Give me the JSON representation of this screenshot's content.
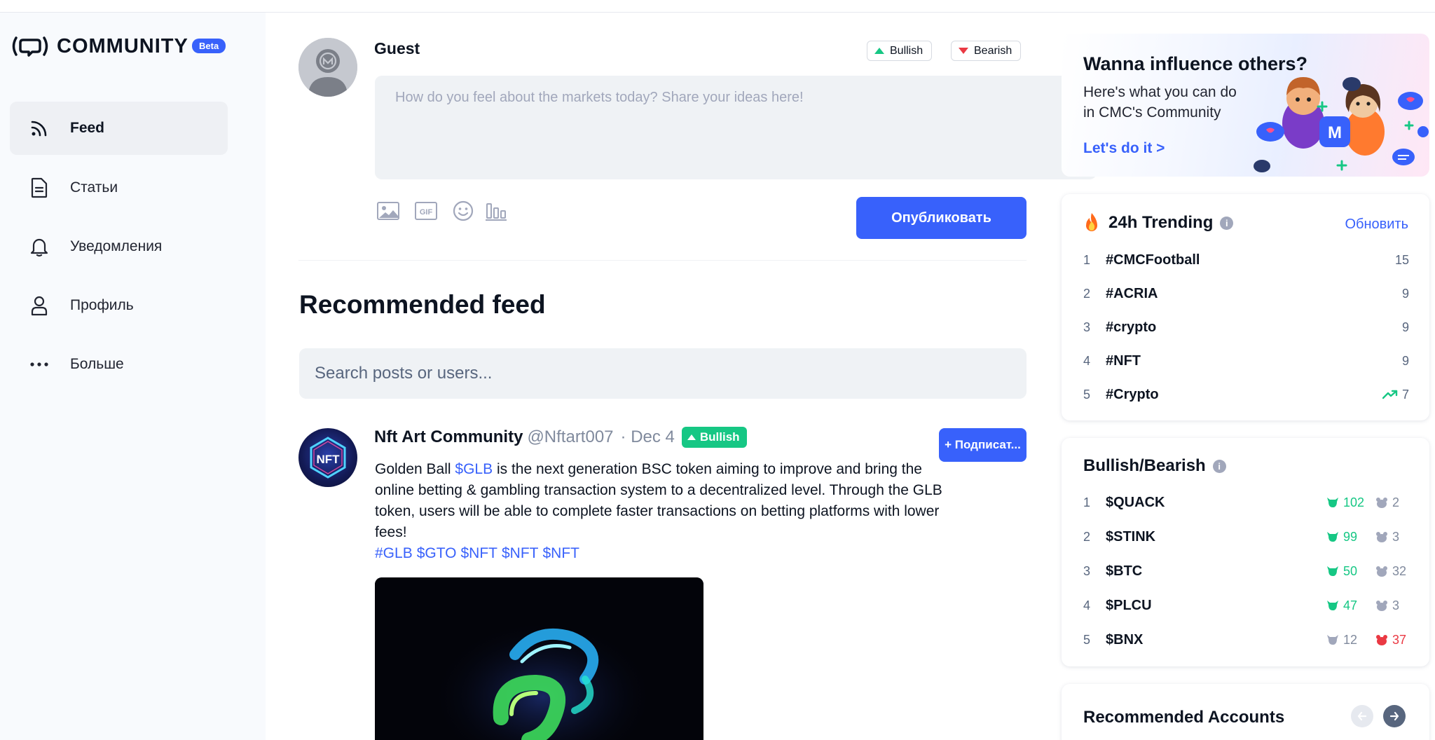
{
  "brand": {
    "name": "COMMUNITY",
    "badge": "Beta"
  },
  "sidebar": {
    "items": [
      {
        "label": "Feed",
        "icon": "rss-icon",
        "active": true
      },
      {
        "label": "Статьи",
        "icon": "document-icon"
      },
      {
        "label": "Уведомления",
        "icon": "bell-icon"
      },
      {
        "label": "Профиль",
        "icon": "user-icon"
      },
      {
        "label": "Больше",
        "icon": "more-dots-icon"
      }
    ]
  },
  "composer": {
    "user": "Guest",
    "bullish_label": "Bullish",
    "bearish_label": "Bearish",
    "placeholder": "How do you feel about the markets today? Share your ideas here!",
    "tools": [
      "image-icon",
      "gif-icon",
      "emoji-icon",
      "poll-icon"
    ],
    "gif_text": "GIF",
    "publish_label": "Опубликовать"
  },
  "feed": {
    "title": "Recommended feed",
    "search_placeholder": "Search posts or users..."
  },
  "post": {
    "author": "Nft Art Community",
    "handle": "@Nftart007",
    "date": "· Dec 4",
    "sentiment": "Bullish",
    "follow_label": "+ Подписат...",
    "text_before": "Golden Ball ",
    "text_link": "$GLB",
    "text_after": " is the next generation BSC token aiming to improve and bring the online betting & gambling transaction system to a decentralized level. Through the GLB token, users will be able to complete faster transactions on betting platforms with lower fees!",
    "tags": [
      "#GLB",
      "$GTO",
      "$NFT",
      "$NFT",
      "$NFT"
    ],
    "avatar_text": "NFT"
  },
  "promo": {
    "title": "Wanna influence others?",
    "subtitle": "Here's what you can do in CMC's Community",
    "cta": "Let's do it >"
  },
  "trending": {
    "title": "24h Trending",
    "refresh_label": "Обновить",
    "rows": [
      {
        "rank": "1",
        "tag": "#CMCFootball",
        "count": "15"
      },
      {
        "rank": "2",
        "tag": "#ACRIA",
        "count": "9"
      },
      {
        "rank": "3",
        "tag": "#crypto",
        "count": "9"
      },
      {
        "rank": "4",
        "tag": "#NFT",
        "count": "9"
      },
      {
        "rank": "5",
        "tag": "#Crypto",
        "count": "7",
        "trending_up": true
      }
    ]
  },
  "bullbear": {
    "title": "Bullish/Bearish",
    "rows": [
      {
        "rank": "1",
        "tag": "$QUACK",
        "bull": "102",
        "bear": "2"
      },
      {
        "rank": "2",
        "tag": "$STINK",
        "bull": "99",
        "bear": "3"
      },
      {
        "rank": "3",
        "tag": "$BTC",
        "bull": "50",
        "bear": "32"
      },
      {
        "rank": "4",
        "tag": "$PLCU",
        "bull": "47",
        "bear": "3"
      },
      {
        "rank": "5",
        "tag": "$BNX",
        "bull": "12",
        "bear": "37",
        "bear_dominant": true
      }
    ]
  },
  "recommended": {
    "title": "Recommended Accounts"
  },
  "colors": {
    "accent": "#3861fb",
    "bull": "#16c784",
    "bear": "#ea3943",
    "sidebar_bg": "#f8fafd"
  }
}
